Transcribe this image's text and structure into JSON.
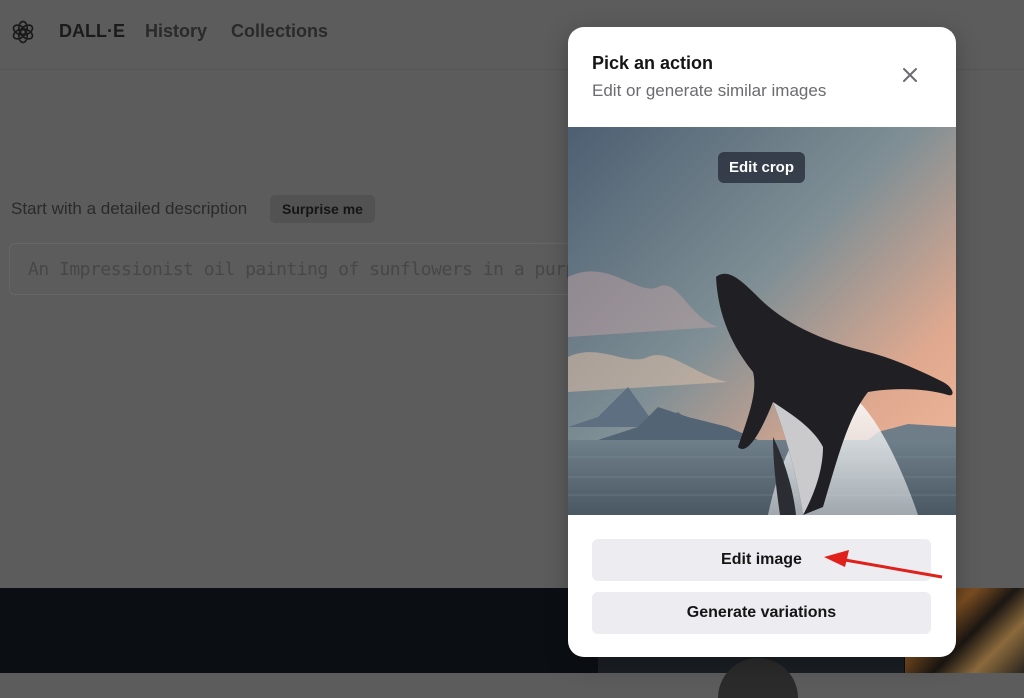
{
  "header": {
    "brand": "DALL·E",
    "nav": [
      {
        "label": "History"
      },
      {
        "label": "Collections"
      }
    ]
  },
  "prompt": {
    "label": "Start with a detailed description",
    "surprise_label": "Surprise me",
    "placeholder": "An Impressionist oil painting of sunflowers in a purple vase..."
  },
  "modal": {
    "title": "Pick an action",
    "subtitle": "Edit or generate similar images",
    "edit_crop_label": "Edit crop",
    "edit_image_label": "Edit image",
    "generate_variations_label": "Generate variations",
    "icons": {
      "close": "close-icon"
    }
  },
  "colors": {
    "overlay_bg": "#5c5c5c",
    "button_bg": "#ececf1",
    "annotation_arrow": "#e0201b"
  }
}
